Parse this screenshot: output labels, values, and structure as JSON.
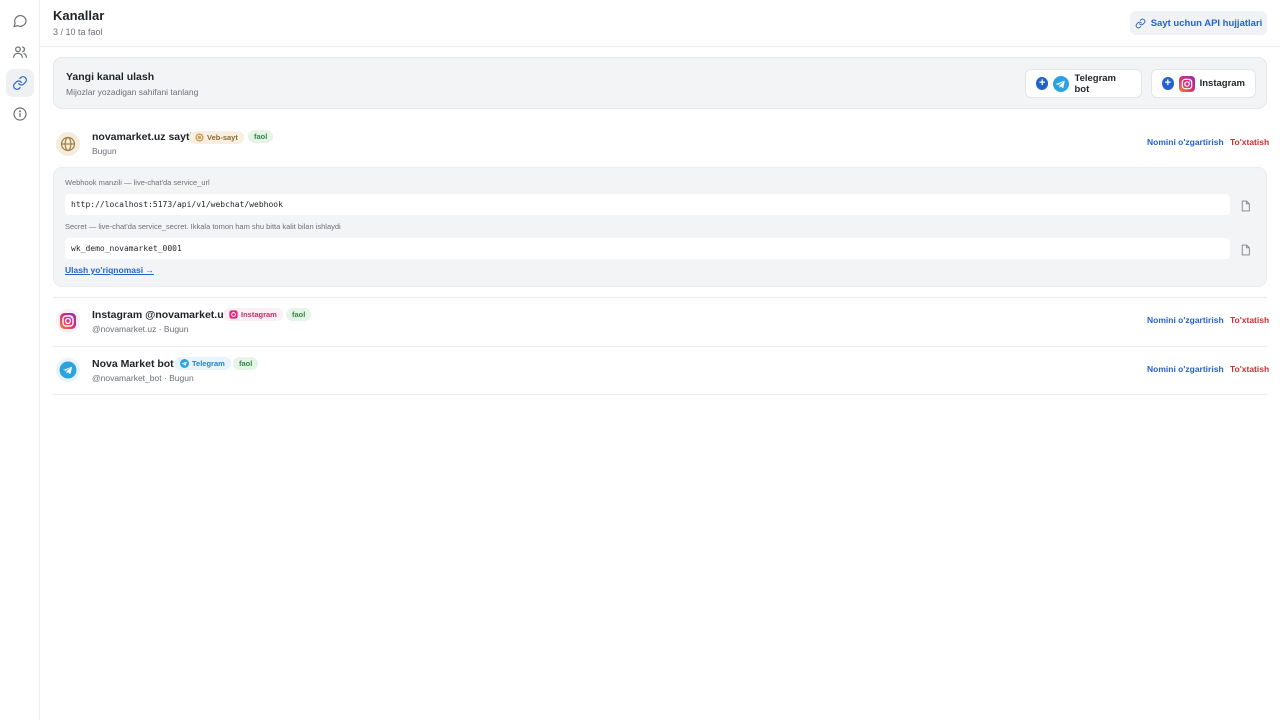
{
  "sidebar": {
    "items": [
      {
        "icon": "chat-icon"
      },
      {
        "icon": "users-icon"
      },
      {
        "icon": "link-icon",
        "active": true
      },
      {
        "icon": "info-icon"
      }
    ]
  },
  "header": {
    "title": "Kanallar",
    "subtitle": "3 / 10 ta faol",
    "api_docs_label": "Sayt uchun API hujjatlari"
  },
  "new_channel": {
    "title": "Yangi kanal ulash",
    "subtitle": "Mijozlar yozadigan sahifani tanlang",
    "telegram_label": "Telegram bot",
    "instagram_label": "Instagram"
  },
  "channels": [
    {
      "name": "novamarket.uz sayti",
      "type_label": "Veb-sayt",
      "status": "faol",
      "meta": "Bugun",
      "rename_label": "Nomini o'zgartirish",
      "stop_label": "To'xtatish",
      "webhook": {
        "url_label": "Webhook manzili — live-chat'da service_url",
        "url_value": "http://localhost:5173/api/v1/webchat/webhook",
        "secret_label": "Secret — live-chat'da service_secret. Ikkala tomon ham shu bitta kalit bilan ishlaydi",
        "secret_value": "wk_demo_novamarket_0001",
        "guide_link": "Ulash yo'riqnomasi →"
      }
    },
    {
      "name": "Instagram @novamarket.uz",
      "type_label": "Instagram",
      "status": "faol",
      "meta": "@novamarket.uz · Bugun",
      "rename_label": "Nomini o'zgartirish",
      "stop_label": "To'xtatish"
    },
    {
      "name": "Nova Market bot",
      "type_label": "Telegram",
      "status": "faol",
      "meta": "@novamarket_bot · Bugun",
      "rename_label": "Nomini o'zgartirish",
      "stop_label": "To'xtatish"
    }
  ],
  "colors": {
    "accent": "#2563c9",
    "danger": "#c93131",
    "success": "#2f8a44",
    "telegram": "#2aa3e0",
    "instagram_a": "#f58529",
    "instagram_b": "#dd2a7b",
    "instagram_c": "#8134af"
  }
}
